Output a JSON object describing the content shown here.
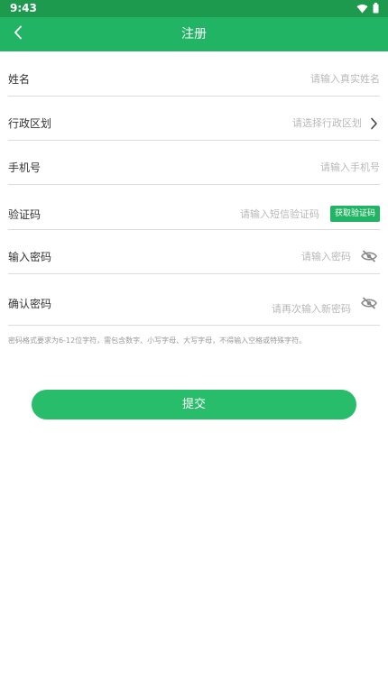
{
  "status_bar": {
    "time": "9:43",
    "icons": [
      "wifi-icon",
      "battery-icon"
    ]
  },
  "app_bar": {
    "title": "注册",
    "back_icon": "back-arrow-icon"
  },
  "form": {
    "name": {
      "label": "姓名",
      "placeholder": "请输入真实姓名",
      "value": ""
    },
    "region": {
      "label": "行政区划",
      "placeholder": "请选择行政区划",
      "icon": "chevron-right-icon"
    },
    "phone": {
      "label": "手机号",
      "placeholder": "请输入手机号",
      "value": ""
    },
    "code": {
      "label": "验证码",
      "placeholder": "请输入短信验证码",
      "value": "",
      "button_label": "获取验证码"
    },
    "password": {
      "label": "输入密码",
      "placeholder": "请输入密码",
      "value": "",
      "toggle_icon": "eye-off-icon"
    },
    "confirm_password": {
      "label": "确认密码",
      "placeholder": "请再次输入新密码",
      "value": "",
      "toggle_icon": "eye-off-icon"
    },
    "hint": "密码格式要求为6-12位字符，需包含数字、小写字母、大写字母，不得输入空格或特殊字符。"
  },
  "submit": {
    "label": "提交"
  },
  "colors": {
    "status_bar": "#1e9a4f",
    "primary": "#22b465",
    "button": "#27bd6a",
    "placeholder": "#b8b8b8",
    "divider": "#dcdcdc"
  }
}
